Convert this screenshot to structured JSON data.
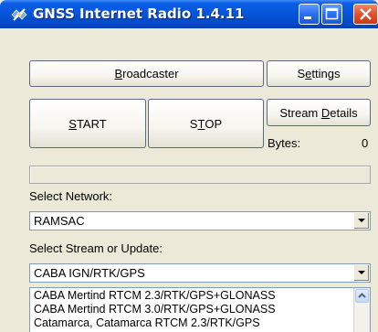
{
  "window": {
    "title": "GNSS Internet Radio 1.4.11"
  },
  "buttons": {
    "broadcaster": {
      "pre": "",
      "key": "B",
      "post": "roadcaster"
    },
    "settings": {
      "pre": "S",
      "key": "e",
      "post": "ttings"
    },
    "start": {
      "pre": "",
      "key": "S",
      "post": "TART"
    },
    "stop": {
      "pre": "S",
      "key": "T",
      "post": "OP"
    },
    "stream_details": {
      "pre": "Stream ",
      "key": "D",
      "post": "etails"
    }
  },
  "bytes": {
    "label": "Bytes:",
    "value": "0"
  },
  "network": {
    "label": "Select Network:",
    "selected": "RAMSAC"
  },
  "stream": {
    "label": "Select Stream or Update:",
    "selected": "CABA IGN/RTK/GPS",
    "list_items": [
      "CABA Mertind RTCM 2.3/RTK/GPS+GLONASS",
      "CABA Mertind RTCM 3.0/RTK/GPS+GLONASS",
      "Catamarca, Catamarca RTCM 2.3/RTK/GPS"
    ]
  },
  "icons": {
    "app": "satellite-icon",
    "minimize": "minimize-icon",
    "maximize": "maximize-icon",
    "close": "close-icon",
    "dropdown": "chevron-down-icon",
    "scroll_up": "scroll-up-icon"
  },
  "colors": {
    "titlebar": "#0553d6",
    "window_bg": "#ece9d8",
    "close_button": "#e2502c"
  }
}
